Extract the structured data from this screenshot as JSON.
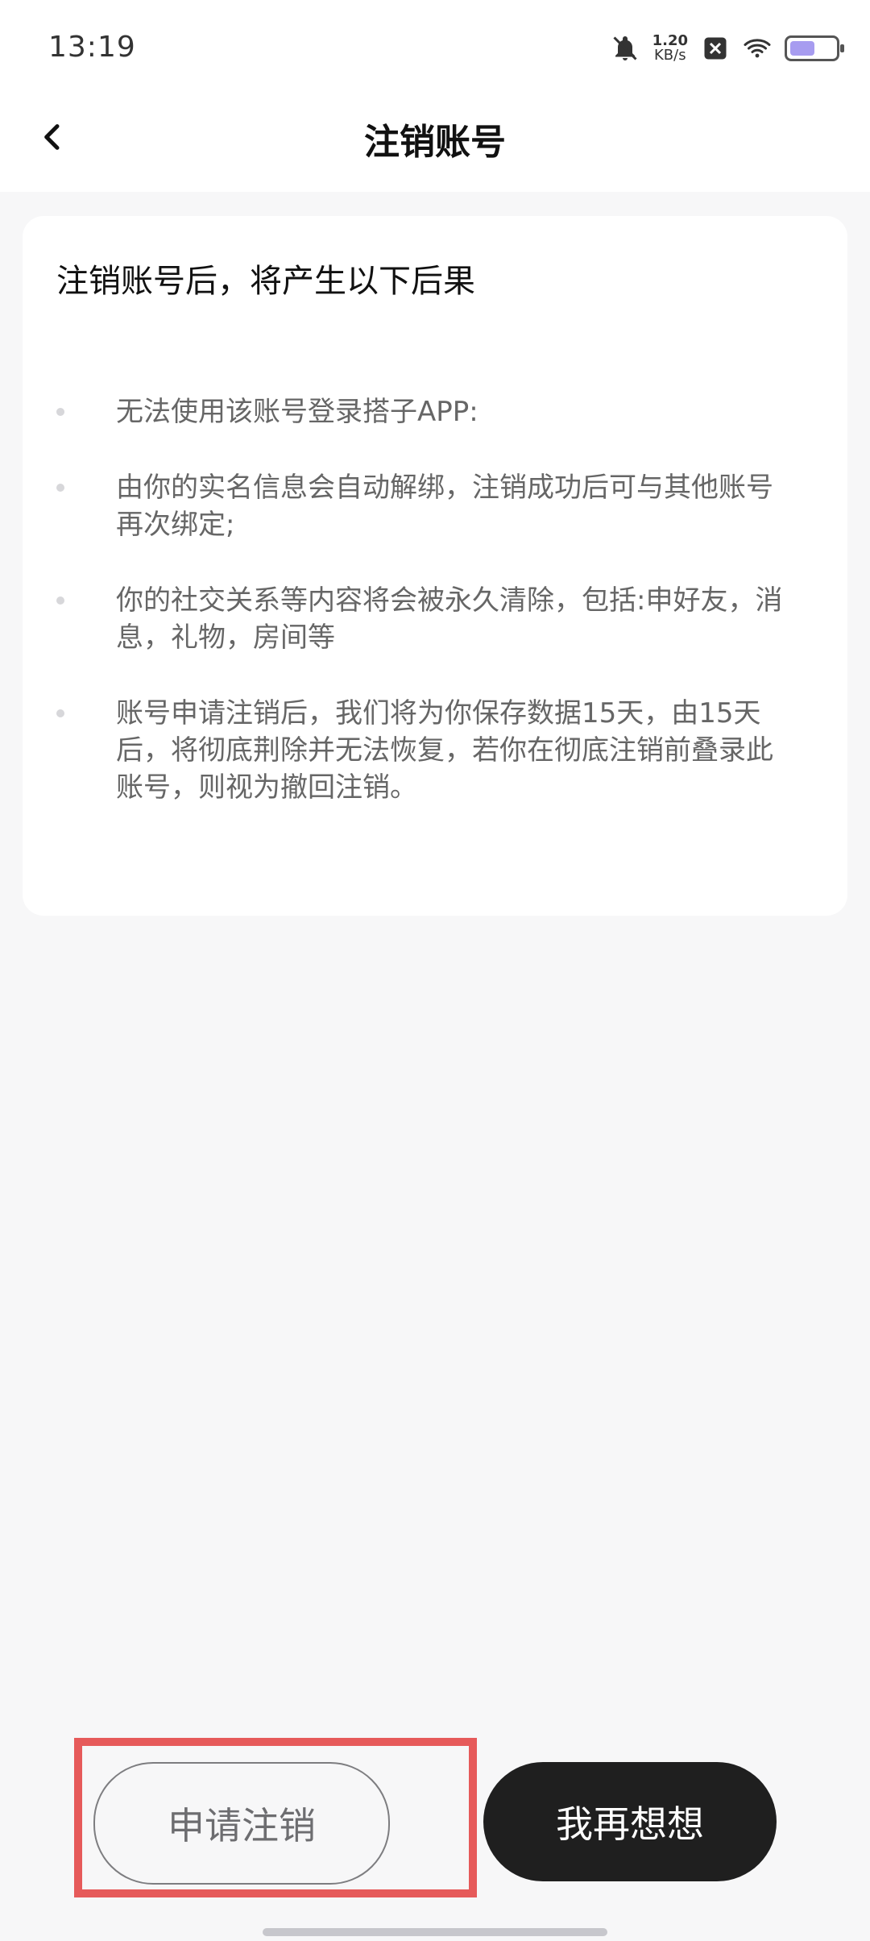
{
  "status_bar": {
    "time": "13:19",
    "net_speed_value": "1.20",
    "net_speed_unit": "KB/s",
    "icons": [
      "bell-off-icon",
      "close-box-icon",
      "wifi-icon",
      "battery-icon"
    ],
    "battery_level": 0.48,
    "colors": {
      "battery_fill": "#a79cf0"
    }
  },
  "header": {
    "title": "注销账号"
  },
  "card": {
    "title": "注销账号后，将产生以下后果",
    "items": [
      "无法使用该账号登录搭子APP:",
      "由你的实名信息会自动解绑，注销成功后可与其他账号再次绑定;",
      "你的社交关系等内容将会被永久清除，包括:申好友，消息，礼物，房间等",
      "账号申请注销后，我们将为你保存数据15天，由15天后，将彻底荆除并无法恢复，若你在彻底注销前叠录此账号，则视为撤回注销。"
    ]
  },
  "actions": {
    "apply_cancel": "申请注销",
    "rethink": "我再想想"
  },
  "colors": {
    "accent_highlight": "#e65a5a",
    "solid_button": "#1f1f1f",
    "background": "#f7f7f8"
  }
}
